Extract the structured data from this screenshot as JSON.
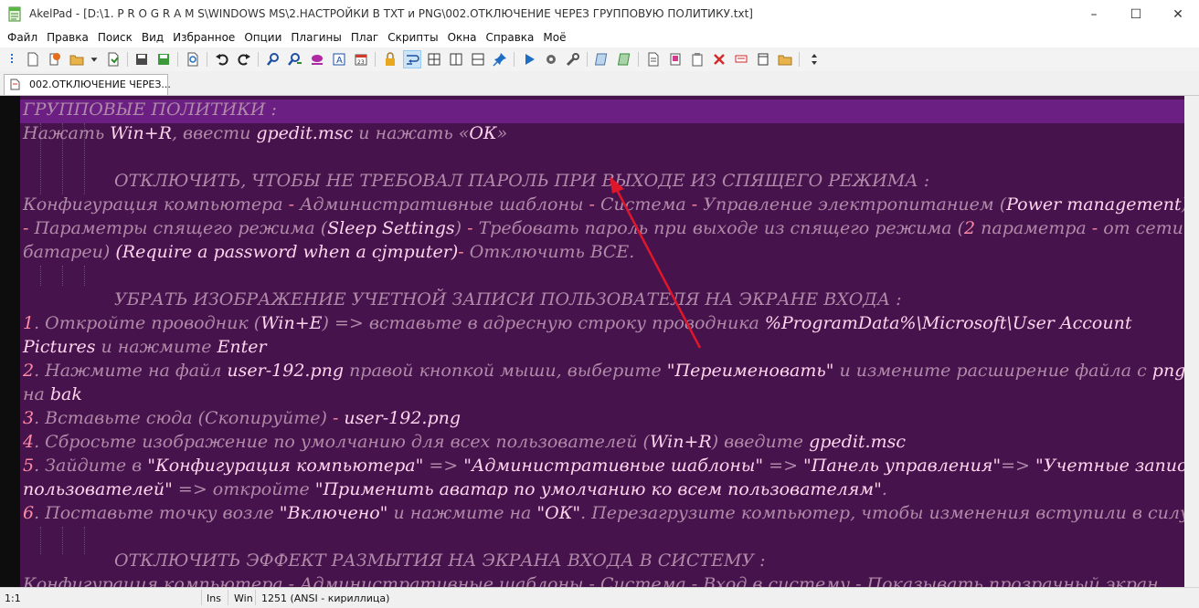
{
  "window": {
    "title": "AkelPad - [D:\\1. P R O G R A M S\\WINDOWS MS\\2.НАСТРОЙКИ В TXT и PNG\\002.ОТКЛЮЧЕНИЕ ЧЕРЕЗ ГРУППОВУЮ ПОЛИТИКУ.txt]",
    "minimize": "–",
    "maximize": "☐",
    "close": "✕"
  },
  "menu": [
    "Файл",
    "Правка",
    "Поиск",
    "Вид",
    "Избранное",
    "Опции",
    "Плагины",
    "Плаг",
    "Скрипты",
    "Окна",
    "Справка",
    "Моё"
  ],
  "toolbar_icons": [
    "drag-grip",
    "new-file",
    "open-recent",
    "open-folder",
    "open-dropdown",
    "document-properties",
    "save",
    "save-all",
    "print-preview",
    "undo",
    "redo",
    "find",
    "find-replace",
    "find-highlight",
    "text-case",
    "calendar",
    "lock",
    "word-wrap",
    "split-view",
    "split-horizontal",
    "split-vertical",
    "pin",
    "run-script",
    "settings-gear",
    "tools",
    "copy-page",
    "paste-page",
    "insert-text",
    "bookmarks",
    "clipboard-dropdown",
    "delete-dropdown",
    "comment",
    "columns",
    "open-plugins-folder",
    "more-options"
  ],
  "tab": {
    "label": "002.ОТКЛЮЧЕНИЕ ЧЕРЕЗ..."
  },
  "colors": {
    "editor_bg": "#46134d",
    "highlight": "#6b1f82",
    "text": "#b08aa8",
    "keyword": "#ffd4ec",
    "number": "#ff8aa6",
    "arrow": "#e0162b"
  },
  "editor": {
    "l1": "ГРУППОВЫЕ ПОЛИТИКИ :",
    "l2a": "Нажать ",
    "l2b": "Win+R",
    "l2c": ", ввести  ",
    "l2d": "gpedit.msc",
    "l2e": "  и нажать «",
    "l2f": "ОК",
    "l2g": "»",
    "l4": "ОТКЛЮЧИТЬ, ЧТОБЫ НЕ ТРЕБОВАЛ ПАРОЛЬ ПРИ ВЫХОДЕ ИЗ СПЯЩЕГО РЕЖИМА :",
    "l5a": "Конфигурация компьютера ",
    "l5b": "-",
    "l5c": " Административные шаблоны ",
    "l5d": "-",
    "l5e": " Система ",
    "l5f": "-",
    "l5g": " Управление электропитанием ",
    "l5h": "(",
    "l5i": "Power management",
    "l5j": ")",
    "l6a": "-",
    "l6b": " Параметры спящего режима ",
    "l6c": "(",
    "l6d": "Sleep Settings",
    "l6e": ")",
    "l6f": " - ",
    "l6g": "Требовать пароль при выходе из спящего режима (",
    "l6h": "2",
    "l6i": " параметра ",
    "l6j": "-",
    "l6k": " от сети и",
    "l7a": "батареи) ",
    "l7b": "(Require a password when a cjmputer)",
    "l7c": "-",
    "l7d": " Отключить ВСЕ.",
    "l9": "УБРАТЬ ИЗОБРАЖЕНИЕ УЧЕТНОЙ ЗАПИСИ ПОЛЬЗОВАТЕЛЯ НА ЭКРАНЕ ВХОДА :",
    "l10a": "1",
    "l10b": ". Откройте проводник (",
    "l10c": "Win+E",
    "l10d": ") => вставьте в адресную строку проводника   ",
    "l10e": "%ProgramData%\\Microsoft\\User Account",
    "l11a": "Pictures",
    "l11b": "   и нажмите ",
    "l11c": "Enter",
    "l12a": "2",
    "l12b": ". Нажмите на файл ",
    "l12c": "user-192.png",
    "l12d": " правой кнопкой мыши, выберите ",
    "l12e": "\"Переименовать\"",
    "l12f": " и измените расширение файла с ",
    "l12g": "png",
    "l13a": "на ",
    "l13b": "bak",
    "l14a": "3",
    "l14b": ". Вставьте сюда (Скопируйте) ",
    "l14c": "-",
    "l14d": " ",
    "l14e": "user-192.png",
    "l15a": "4",
    "l15b": ". Сбросьте изображение по умолчанию для всех пользователей (",
    "l15c": "Win+R",
    "l15d": ") введите ",
    "l15e": "gpedit.msc",
    "l16a": "5",
    "l16b": ". Зайдите в ",
    "l16c": "\"Конфигурация компьютера\"",
    "l16d": " => ",
    "l16e": "\"Административные шаблоны\"",
    "l16f": " => ",
    "l16g": "\"Панель управления\"",
    "l16h": "=> ",
    "l16i": "\"Учетные записи",
    "l17a": "пользователей\"",
    "l17b": " => откройте ",
    "l17c": "\"Применить аватар по умолчанию ко всем пользователям\"",
    "l17d": ".",
    "l18a": "6",
    "l18b": ". Поставьте точку возле ",
    "l18c": "\"Включено\"",
    "l18d": " и нажмите на ",
    "l18e": "\"ОК\"",
    "l18f": ". Перезагрузите компьютер, чтобы изменения вступили в силу",
    "l20": "ОТКЛЮЧИТЬ ЭФФЕКТ РАЗМЫТИЯ НА ЭКРАНА ВХОДА В СИСТЕМУ :",
    "l21": "Конфигурация компьютера - Административные шаблоны - Система - Вход в систему - Показывать прозрачный экран"
  },
  "status": {
    "position": "1:1",
    "mode": "Ins",
    "newline": "Win",
    "codepage": "1251  (ANSI - кириллица)"
  }
}
